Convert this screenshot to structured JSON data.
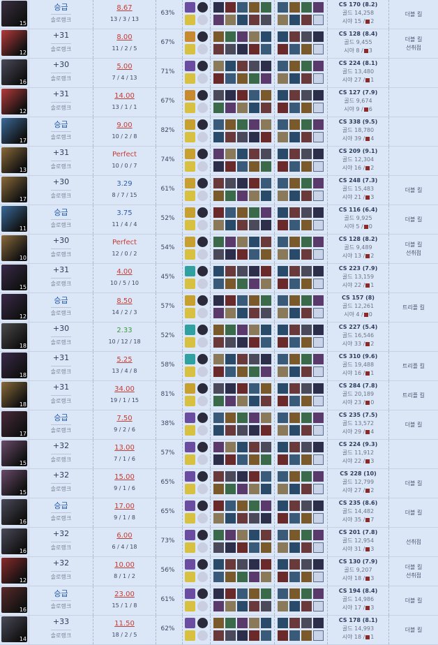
{
  "queue_label": "솔로랭크",
  "rows": [
    {
      "lvl": "15",
      "result": "승급",
      "kda": "8.67",
      "score": "13 / 3 / 13",
      "pct": "63%",
      "cs": "CS 170 (8.2)",
      "gold": "골드 14,258",
      "vision": "시야 15 /",
      "wards": "2",
      "m1": "",
      "m2": "",
      "m3": "더블 킬",
      "m4": "",
      "portrait": "#3a3040",
      "rune": "#6a4da0"
    },
    {
      "lvl": "12",
      "result": "+31",
      "kda": "8.00",
      "score": "11 / 2 / 5",
      "pct": "67%",
      "cs": "CS 128 (8.4)",
      "gold": "골드 9,455",
      "vision": "시야 8 /",
      "wards": "3",
      "m1": "",
      "m2": "",
      "m3": "더블 킬",
      "m4": "선취점",
      "portrait": "#b43a3a",
      "rune": "#c88a30"
    },
    {
      "lvl": "16",
      "result": "+30",
      "kda": "5.00",
      "score": "7 / 4 / 13",
      "pct": "71%",
      "cs": "CS 224 (8.1)",
      "gold": "골드 13,480",
      "vision": "시야 27 /",
      "wards": "1",
      "m1": "",
      "m2": "",
      "m3": "",
      "m4": "",
      "portrait": "#4a4a5a",
      "rune": "#6a4da0"
    },
    {
      "lvl": "12",
      "result": "+31",
      "kda": "14.00",
      "score": "13 / 1 / 1",
      "pct": "67%",
      "cs": "CS 127 (7.9)",
      "gold": "골드 9,674",
      "vision": "시야 9 /",
      "wards": "6",
      "m1": "",
      "m2": "",
      "m3": "",
      "m4": "",
      "portrait": "#b43a3a",
      "rune": "#c88a30"
    },
    {
      "lvl": "17",
      "result": "승급",
      "kda": "9.00",
      "score": "10 / 2 / 8",
      "pct": "82%",
      "cs": "CS 338 (9.5)",
      "gold": "골드 18,780",
      "vision": "시야 39 /",
      "wards": "4",
      "m1": "",
      "m2": "",
      "m3": "",
      "m4": "",
      "portrait": "#3a6a9a",
      "rune": "#c8a030"
    },
    {
      "lvl": "13",
      "result": "+31",
      "kda": "Perfect",
      "score": "10 / 0 / 7",
      "pct": "74%",
      "cs": "CS 209 (9.1)",
      "gold": "골드 12,304",
      "vision": "시야 16 /",
      "wards": "2",
      "m1": "",
      "m2": "",
      "m3": "",
      "m4": "",
      "portrait": "#8a6a3a",
      "rune": "#c8a030"
    },
    {
      "lvl": "17",
      "result": "+30",
      "kda": "3.29",
      "score": "8 / 7 / 15",
      "pct": "61%",
      "cs": "CS 248 (7.3)",
      "gold": "골드 15,483",
      "vision": "시야 21 /",
      "wards": "3",
      "m1": "",
      "m2": "",
      "m3": "더블 킬",
      "m4": "",
      "portrait": "#8a6a3a",
      "rune": "#c8a030"
    },
    {
      "lvl": "11",
      "result": "승급",
      "kda": "3.75",
      "score": "11 / 4 / 4",
      "pct": "52%",
      "cs": "CS 116 (6.4)",
      "gold": "골드 9,925",
      "vision": "시야 5 /",
      "wards": "0",
      "m1": "",
      "m2": "",
      "m3": "더블 킬",
      "m4": "",
      "portrait": "#3a6a9a",
      "rune": "#c8a030"
    },
    {
      "lvl": "10",
      "result": "+30",
      "kda": "Perfect",
      "score": "12 / 0 / 2",
      "pct": "54%",
      "cs": "CS 128 (8.2)",
      "gold": "골드 9,489",
      "vision": "시야 13 /",
      "wards": "2",
      "m1": "",
      "m2": "",
      "m3": "더블 킬",
      "m4": "선취점",
      "portrait": "#8a6a3a",
      "rune": "#c8a030"
    },
    {
      "lvl": "15",
      "result": "+31",
      "kda": "4.00",
      "score": "10 / 5 / 10",
      "pct": "45%",
      "cs": "CS 223 (7.9)",
      "gold": "골드 13,159",
      "vision": "시야 22 /",
      "wards": "1",
      "m1": "",
      "m2": "",
      "m3": "",
      "m4": "",
      "portrait": "#3a2a4a",
      "rune": "#30a0a0"
    },
    {
      "lvl": "12",
      "result": "승급",
      "kda": "8.50",
      "score": "14 / 2 / 3",
      "pct": "57%",
      "cs": "CS 157 (8)",
      "gold": "골드 12,261",
      "vision": "시야 4 /",
      "wards": "0",
      "m1": "",
      "m2": "",
      "m3": "트리플 킬",
      "m4": "",
      "portrait": "#3a2a4a",
      "rune": "#c8a030"
    },
    {
      "lvl": "18",
      "result": "+30",
      "kda": "2.33",
      "score": "10 / 12 / 18",
      "pct": "52%",
      "cs": "CS 227 (5.4)",
      "gold": "골드 16,546",
      "vision": "시야 33 /",
      "wards": "2",
      "m1": "",
      "m2": "",
      "m3": "",
      "m4": "",
      "portrait": "#4a4a4a",
      "rune": "#30a0a0"
    },
    {
      "lvl": "18",
      "result": "+31",
      "kda": "5.25",
      "score": "13 / 4 / 8",
      "pct": "58%",
      "cs": "CS 310 (9.6)",
      "gold": "골드 19,488",
      "vision": "시야 16 /",
      "wards": "1",
      "m1": "",
      "m2": "",
      "m3": "트리플 킬",
      "m4": "",
      "portrait": "#3a2a4a",
      "rune": "#30a0a0"
    },
    {
      "lvl": "18",
      "result": "+31",
      "kda": "34.00",
      "score": "19 / 1 / 15",
      "pct": "81%",
      "cs": "CS 284 (7.8)",
      "gold": "골드 20,189",
      "vision": "시야 23 /",
      "wards": "0",
      "m1": "",
      "m2": "",
      "m3": "트리플 킬",
      "m4": "",
      "portrait": "#8a6a3a",
      "rune": "#c8a030"
    },
    {
      "lvl": "17",
      "result": "승급",
      "kda": "7.50",
      "score": "9 / 2 / 6",
      "pct": "38%",
      "cs": "CS 235 (7.5)",
      "gold": "골드 13,572",
      "vision": "시야 29 /",
      "wards": "4",
      "m1": "",
      "m2": "",
      "m3": "더블 킬",
      "m4": "",
      "portrait": "#4a2a3a",
      "rune": "#6a4da0"
    },
    {
      "lvl": "15",
      "result": "+32",
      "kda": "13.00",
      "score": "7 / 1 / 6",
      "pct": "57%",
      "cs": "CS 224 (9.3)",
      "gold": "골드 11,912",
      "vision": "시야 22 /",
      "wards": "3",
      "m1": "",
      "m2": "",
      "m3": "",
      "m4": "",
      "portrait": "#6a4a6a",
      "rune": "#6a4da0"
    },
    {
      "lvl": "15",
      "result": "+32",
      "kda": "15.00",
      "score": "9 / 1 / 6",
      "pct": "65%",
      "cs": "CS 228 (10)",
      "gold": "골드 12,799",
      "vision": "시야 27 /",
      "wards": "2",
      "m1": "",
      "m2": "",
      "m3": "더블 킬",
      "m4": "",
      "portrait": "#6a4a6a",
      "rune": "#6a4da0"
    },
    {
      "lvl": "16",
      "result": "승급",
      "kda": "17.00",
      "score": "9 / 1 / 8",
      "pct": "65%",
      "cs": "CS 235 (8.6)",
      "gold": "골드 14,482",
      "vision": "시야 35 /",
      "wards": "7",
      "m1": "",
      "m2": "",
      "m3": "더블 킬",
      "m4": "",
      "portrait": "#4a4a5a",
      "rune": "#6a4da0"
    },
    {
      "lvl": "16",
      "result": "+32",
      "kda": "6.00",
      "score": "6 / 4 / 18",
      "pct": "73%",
      "cs": "CS 201 (7.8)",
      "gold": "골드 12,954",
      "vision": "시야 31 /",
      "wards": "3",
      "m1": "",
      "m2": "",
      "m3": "선취점",
      "m4": "",
      "portrait": "#4a4a5a",
      "rune": "#6a4da0"
    },
    {
      "lvl": "12",
      "result": "+32",
      "kda": "10.00",
      "score": "8 / 1 / 2",
      "pct": "56%",
      "cs": "CS 130 (7.9)",
      "gold": "골드 9,207",
      "vision": "시야 18 /",
      "wards": "3",
      "m1": "",
      "m2": "",
      "m3": "더블 킬",
      "m4": "선취점",
      "portrait": "#8a2a2a",
      "rune": "#6a4da0"
    },
    {
      "lvl": "16",
      "result": "승급",
      "kda": "23.00",
      "score": "15 / 1 / 8",
      "pct": "61%",
      "cs": "CS 194 (8.4)",
      "gold": "골드 14,986",
      "vision": "시야 17 /",
      "wards": "3",
      "m1": "",
      "m2": "",
      "m3": "더블 킬",
      "m4": "",
      "portrait": "#5a2a2a",
      "rune": "#6a4da0"
    },
    {
      "lvl": "14",
      "result": "+33",
      "kda": "11.50",
      "score": "18 / 2 / 5",
      "pct": "62%",
      "cs": "CS 178 (8.1)",
      "gold": "골드 14,993",
      "vision": "시야 18 /",
      "wards": "1",
      "m1": "",
      "m2": "",
      "m3": "더블 킬",
      "m4": "",
      "portrait": "#4a4a5a",
      "rune": "#6a4da0"
    }
  ]
}
